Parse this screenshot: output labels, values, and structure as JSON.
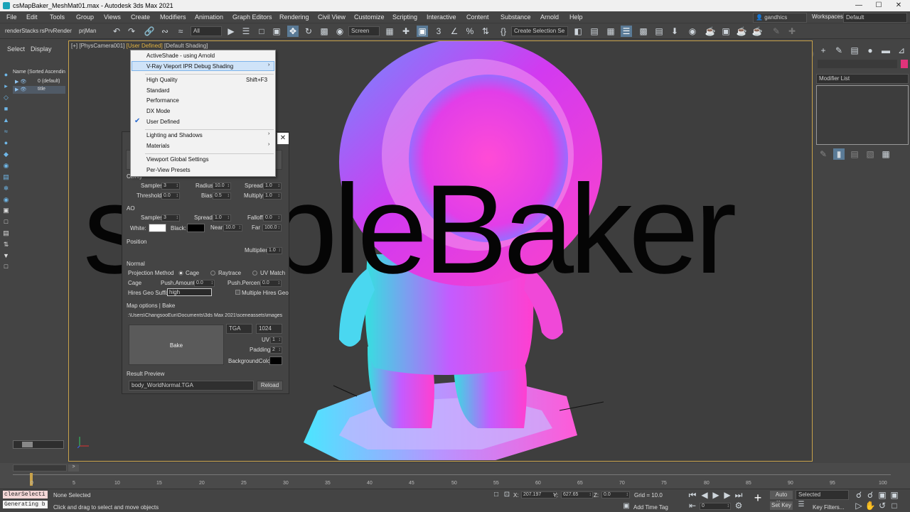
{
  "window": {
    "title": "csMapBaker_MeshMat01.max - Autodesk 3ds Max 2021"
  },
  "menu": [
    "File",
    "Edit",
    "Tools",
    "Group",
    "Views",
    "Create",
    "Modifiers",
    "Animation",
    "Graph Editors",
    "Rendering",
    "Civil View",
    "Customize",
    "Scripting",
    "Interactive",
    "Content",
    "Substance",
    "Arnold",
    "Help"
  ],
  "user": {
    "name": "gandhics",
    "workspaces_label": "Workspaces:",
    "workspace": "Default"
  },
  "toolbar": {
    "tab1": "renderStacks",
    "tab2": "rsPrvRender",
    "tab3": "prjMan",
    "filter": "All",
    "refcoord": "Screen",
    "selection_set": "Create Selection Se"
  },
  "scene_explorer": {
    "tab_select": "Select",
    "tab_display": "Display",
    "column": "Name (Sorted Ascendin",
    "items": [
      "0 (default)",
      "title"
    ]
  },
  "viewport": {
    "label_prefix": "[+]  [PhysCamera001]",
    "label_mode": "[User Defined]",
    "label_shading": "[Default Shading]",
    "big_text": "simpleBaker"
  },
  "dropdown": {
    "items": [
      "ActiveShade - using Arnold",
      "V-Ray Vieport IPR Debug Shading",
      "High Quality",
      "Standard",
      "Performance",
      "DX Mode",
      "User Defined",
      "Lighting and Shadows",
      "Materials",
      "Viewport Global Settings",
      "Per-View Presets"
    ],
    "shortcut_high_quality": "Shift+F3"
  },
  "bake": {
    "cavity_label": "Cavity",
    "cav_samples_label": "Samples",
    "cav_samples": "3",
    "cav_radius_label": "Radius",
    "cav_radius": "10.0",
    "cav_spread_label": "Spread",
    "cav_spread": "1.0",
    "cav_threshold_label": "Threshold",
    "cav_threshold": "0.0",
    "cav_bias_label": "Bias",
    "cav_bias": "0.5",
    "cav_multiply_label": "Multiply",
    "cav_multiply": "1.0",
    "ao_label": "AO",
    "ao_samples_label": "Samples",
    "ao_samples": "3",
    "ao_spread_label": "Spread",
    "ao_spread": "1.0",
    "ao_falloff_label": "Falloff",
    "ao_falloff": "0.0",
    "ao_white_label": "White:",
    "ao_black_label": "Black:",
    "ao_near_label": "Near",
    "ao_near": "10.0",
    "ao_far_label": "Far",
    "ao_far": "100.0",
    "position_label": "Position",
    "multiplier_label": "Multiplier",
    "multiplier": "1.0",
    "normal_label": "Normal",
    "proj_method_label": "Projection Method",
    "proj_cage": "Cage",
    "proj_raytrace": "Raytrace",
    "proj_uvmatch": "UV Match",
    "cage_label": "Cage",
    "push_amount_label": "Push.Amount",
    "push_amount": "0.0",
    "push_percent_label": "Push.Percent",
    "push_percent": "0.0",
    "hires_suffix_label": "Hires Geo Suffix",
    "hires_suffix": "high",
    "multiple_hires_label": "Multiple Hires Geo",
    "map_options_label": "Map options | Bake",
    "path": ":\\Users\\ChangsooEun\\Documents\\3ds Max 2021\\sceneassets\\images",
    "format": "TGA",
    "size": "1024",
    "bake_button": "Bake",
    "uv_label": "UV",
    "uv": "1",
    "padding_label": "Padding",
    "padding": "2",
    "bgcolor_label": "BackgroundColor",
    "result_preview_label": "Result Preview",
    "result_file": "body_WorldNormal.TGA",
    "reload_button": "Reload"
  },
  "command_panel": {
    "modifier_list": "Modifier List"
  },
  "timeline": {
    "frame": "0 / 100",
    "ticks": [
      "0",
      "5",
      "10",
      "15",
      "20",
      "25",
      "30",
      "35",
      "40",
      "45",
      "50",
      "55",
      "60",
      "65",
      "70",
      "75",
      "80",
      "85",
      "90",
      "95",
      "100"
    ]
  },
  "status": {
    "script1": "clearSelecti",
    "script2": "Generating b",
    "selection": "None Selected",
    "prompt": "Click and drag to select and move objects",
    "x_label": "X:",
    "x": "207.197",
    "y_label": "Y:",
    "y": "627.65",
    "z_label": "Z:",
    "z": "0.0",
    "grid": "Grid = 10.0",
    "add_time_tag": "Add Time Tag",
    "auto_key": "Auto Key",
    "set_key": "Set Key",
    "key_mode": "Selected",
    "key_filters": "Key Filters...",
    "frame_field": "0"
  },
  "colors": {
    "accent_border": "#c8a24a",
    "ui_bg": "#444444",
    "highlight": "#cfe3f8"
  }
}
